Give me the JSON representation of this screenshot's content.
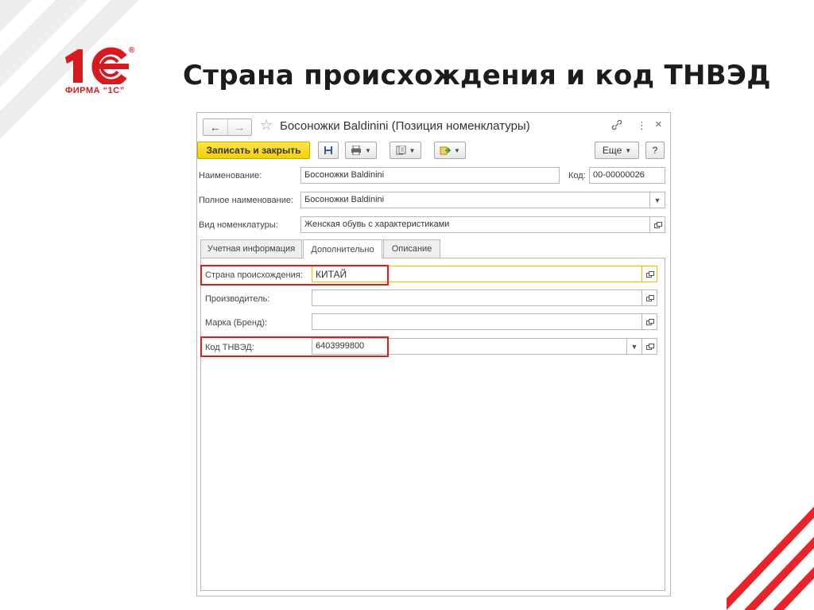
{
  "slide": {
    "title": "Страна происхождения и код ТНВЭД",
    "logo_text": "1С",
    "logo_subtitle": "ФИРМА “1С”",
    "logo_reg": "®",
    "accent_color": "#d71920"
  },
  "window": {
    "title": "Босоножки Baldinini (Позиция номенклатуры)",
    "nav_back": "←",
    "nav_forward": "→",
    "star": "☆",
    "link_icon": "🔗",
    "menu_icon": "⋮",
    "close_icon": "×"
  },
  "toolbar": {
    "save_close_label": "Записать и закрыть",
    "more_label": "Еще",
    "help_label": "?",
    "save_icon": "save-icon",
    "print_icon": "print-icon",
    "reports_icon": "reports-icon",
    "create_based_icon": "create-based-icon",
    "primary_color": "#f5cf00"
  },
  "fields": {
    "name_label": "Наименование:",
    "name_value": "Босоножки Baldinini",
    "code_label": "Код:",
    "code_value": "00-00000026",
    "full_name_label": "Полное наименование:",
    "full_name_value": "Босоножки Baldinini",
    "type_label": "Вид номенклатуры:",
    "type_value": "Женская обувь с характеристиками"
  },
  "tabs": [
    {
      "label": "Учетная информация",
      "active": false
    },
    {
      "label": "Дополнительно",
      "active": true
    },
    {
      "label": "Описание",
      "active": false
    }
  ],
  "extra": {
    "country_label": "Страна происхождения:",
    "country_value": "КИТАЙ",
    "manufacturer_label": "Производитель:",
    "manufacturer_value": "",
    "brand_label": "Марка (Бренд):",
    "brand_value": "",
    "tnved_label": "Код ТНВЭД:",
    "tnved_value": "6403999800"
  },
  "highlight_color": "#e01b22"
}
